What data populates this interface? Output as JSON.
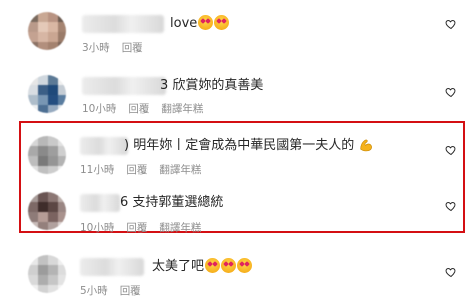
{
  "comments": [
    {
      "text": "love",
      "emoji_suffix": [
        "heart-eyes-emoji",
        "heart-eyes-emoji"
      ],
      "time": "3小時",
      "reply": "回覆",
      "translate": ""
    },
    {
      "text": "3 欣賞妳的真善美",
      "emoji_suffix": [],
      "time": "10小時",
      "reply": "回覆",
      "translate": "翻譯年糕"
    },
    {
      "text": ") 明年妳丨定會成為中華民國第一夫人的",
      "emoji_suffix": [
        "flexed-biceps-emoji"
      ],
      "time": "11小時",
      "reply": "回覆",
      "translate": "翻譯年糕"
    },
    {
      "text": "6 支持郭董選總統",
      "emoji_suffix": [],
      "time": "10小時",
      "reply": "回覆",
      "translate": "翻譯年糕"
    },
    {
      "text": "太美了吧",
      "emoji_suffix": [
        "heart-eyes-emoji",
        "heart-eyes-emoji",
        "heart-eyes-emoji"
      ],
      "time": "5小時",
      "reply": "回覆",
      "translate": ""
    }
  ],
  "colors": {
    "highlight_border": "#d40f13",
    "meta_text": "#8e8e8e",
    "emoji_yellow": "#f7b11f"
  }
}
